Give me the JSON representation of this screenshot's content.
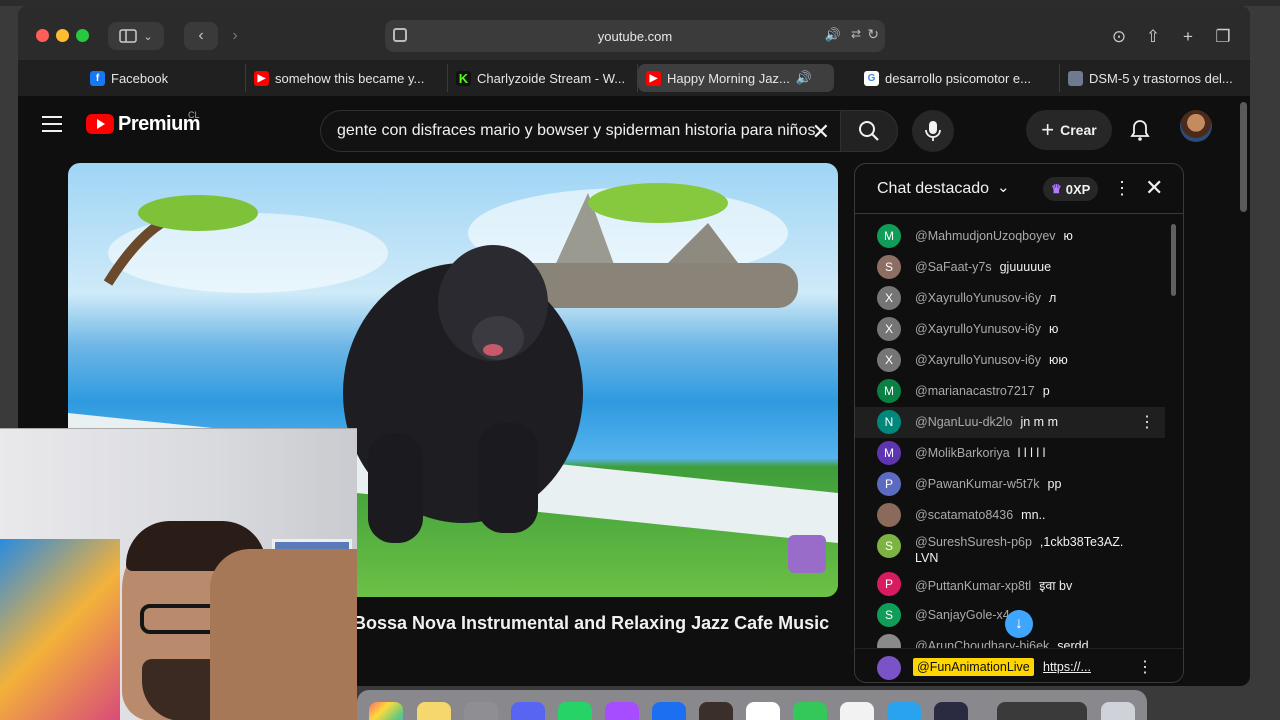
{
  "browser": {
    "url": "youtube.com",
    "tabs": [
      {
        "label": "Facebook",
        "icon": "facebook-icon"
      },
      {
        "label": "somehow this became y...",
        "icon": "youtube-icon"
      },
      {
        "label": "Charlyzoide Stream - W...",
        "icon": "kick-icon"
      },
      {
        "label": "Happy Morning Jaz...",
        "icon": "youtube-icon",
        "active": true
      },
      {
        "label": "desarrollo psicomotor e...",
        "icon": "google-icon"
      },
      {
        "label": "DSM-5 y trastornos del...",
        "icon": "document-icon"
      }
    ]
  },
  "youtube": {
    "logo_text": "Premium",
    "country": "CL",
    "search_query": "gente con disfraces mario y bowser y spiderman historia para niños",
    "create_label": "Crear"
  },
  "video": {
    "title": "Bossa Nova Instrumental and Relaxing Jazz Cafe Music"
  },
  "chat": {
    "title": "Chat destacado",
    "xp": "0XP",
    "messages": [
      {
        "initial": "M",
        "color": "#0f9d58",
        "author": "@MahmudjonUzoqboyev",
        "text": "ю"
      },
      {
        "initial": "S",
        "color": "#8d6e63",
        "author": "@SaFaat-y7s",
        "text": "gjuuuuue"
      },
      {
        "initial": "X",
        "color": "#757575",
        "author": "@XayrulloYunusov-i6y",
        "text": "л"
      },
      {
        "initial": "X",
        "color": "#757575",
        "author": "@XayrulloYunusov-i6y",
        "text": "ю"
      },
      {
        "initial": "X",
        "color": "#757575",
        "author": "@XayrulloYunusov-i6y",
        "text": "юю"
      },
      {
        "initial": "M",
        "color": "#0b8043",
        "author": "@marianacastro7217",
        "text": "p"
      },
      {
        "initial": "N",
        "color": "#00897b",
        "author": "@NganLuu-dk2lo",
        "text": "jn m m"
      },
      {
        "initial": "M",
        "color": "#5e35b1",
        "author": "@MolikBarkoriya",
        "text": "l l l l l"
      },
      {
        "initial": "P",
        "color": "#5c6bc0",
        "author": "@PawanKumar-w5t7k",
        "text": "pp"
      },
      {
        "initial": "",
        "color": "#8a6a5a",
        "author": "@scatamato8436",
        "text": "mn.."
      },
      {
        "initial": "S",
        "color": "#7cb342",
        "author": "@SureshSuresh-p6p",
        "text": ",1ckb38Te3AZ.",
        "text2": "LVN"
      },
      {
        "initial": "P",
        "color": "#d81b60",
        "author": "@PuttanKumar-xp8tl",
        "text": "इवा bv"
      },
      {
        "initial": "S",
        "color": "#0f9d58",
        "author": "@SanjayGole-x4",
        "text": ""
      },
      {
        "initial": "",
        "color": "#8a8a8a",
        "author": "@ArunChoudhary-bi6ek",
        "text": "serdd"
      }
    ],
    "pinned": {
      "author": "@FunAnimationLive",
      "link": "https://..."
    }
  }
}
